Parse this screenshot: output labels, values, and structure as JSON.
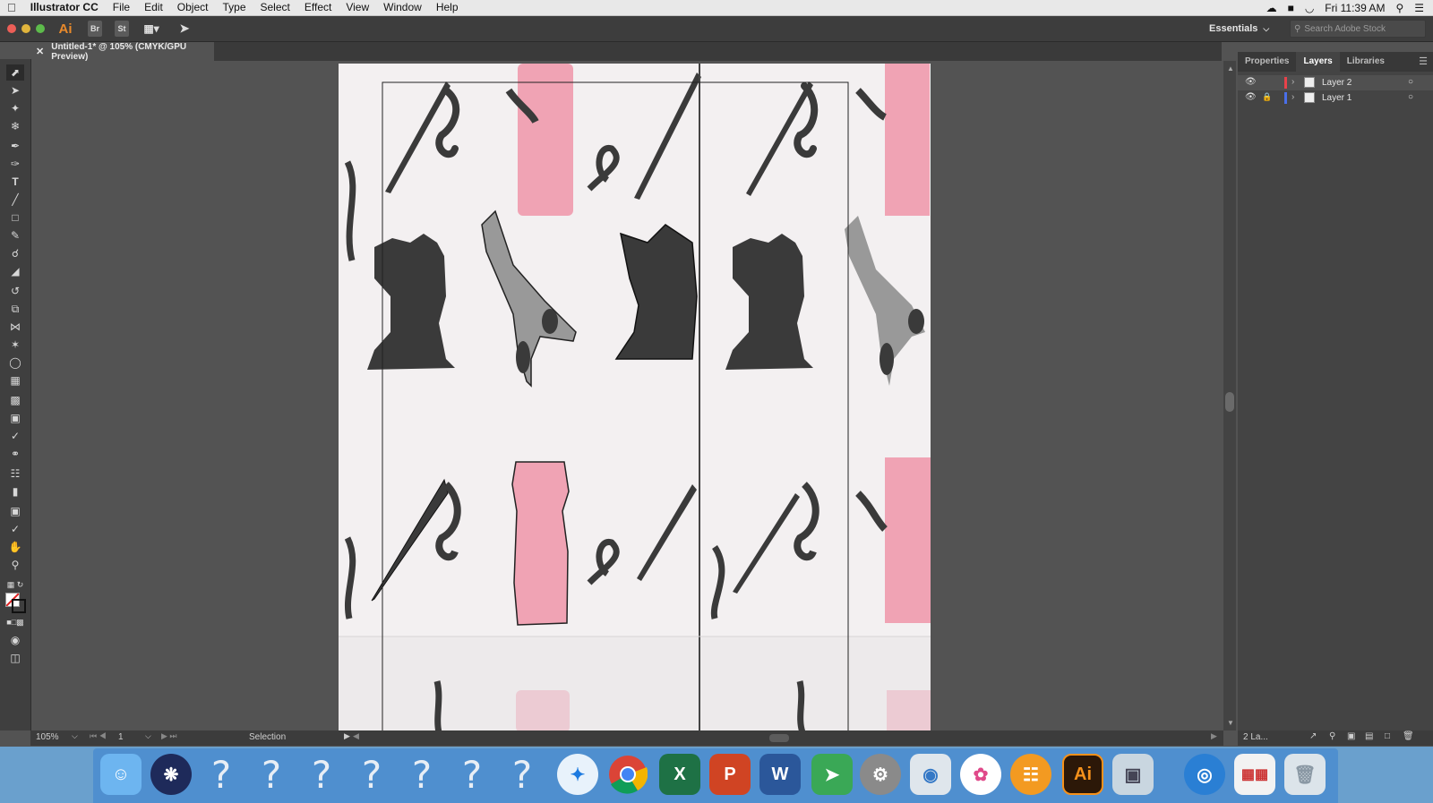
{
  "menubar": {
    "app_name": "Illustrator CC",
    "items": [
      "File",
      "Edit",
      "Object",
      "Type",
      "Select",
      "Effect",
      "View",
      "Window",
      "Help"
    ],
    "clock": "Fri 11:39 AM"
  },
  "appbar": {
    "logo": "Ai",
    "bridge": "Br",
    "stock": "St",
    "workspace": "Essentials",
    "search_placeholder": "Search Adobe Stock"
  },
  "document": {
    "tab_title": "Untitled-1* @ 105% (CMYK/GPU Preview)"
  },
  "panel": {
    "tabs": [
      "Properties",
      "Layers",
      "Libraries"
    ],
    "active_tab": "Layers",
    "layers": [
      {
        "name": "Layer 2",
        "color": "#e9424a",
        "selected": true,
        "locked": false
      },
      {
        "name": "Layer 1",
        "color": "#4a6fe9",
        "selected": false,
        "locked": true
      }
    ],
    "footer_count": "2 La..."
  },
  "status": {
    "zoom": "105%",
    "artboard": "1",
    "tool": "Selection"
  },
  "dock": {
    "apps": [
      "finder-icon",
      "siri-icon",
      "unknown-app-icon",
      "unknown-app-icon",
      "unknown-app-icon",
      "unknown-app-icon",
      "unknown-app-icon",
      "unknown-app-icon",
      "unknown-app-icon",
      "safari-icon",
      "chrome-icon",
      "excel-icon",
      "powerpoint-icon",
      "word-icon",
      "maps-icon",
      "system-preferences-icon",
      "image-capture-icon",
      "photos-icon",
      "ibooks-icon",
      "illustrator-icon",
      "preview-icon",
      "globe-icon",
      "grid-app-icon",
      "trash-icon"
    ],
    "illustrator_label": "Ai",
    "question_glyph": "?"
  },
  "colors": {
    "pink": "#f0a3b4",
    "ink": "#3a3a3a",
    "paper": "#f3f0f1"
  }
}
